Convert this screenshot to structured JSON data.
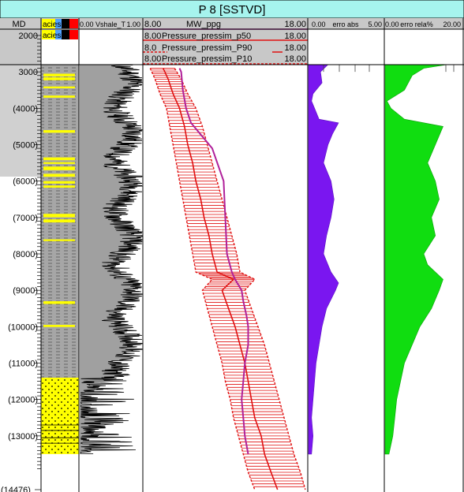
{
  "well_title": "P 8 [SSTVD]",
  "colors": {
    "title_bg": "#a6f4ee",
    "header_bg": "#c8c8c8",
    "track_fill": "#a0a0a0",
    "sand": "#ffff00",
    "shale": "#a6a6a6",
    "mw": "#b0209a",
    "pressure": "#e01010",
    "erro_abs": "#7a16f0",
    "erro_rela": "#10dd10"
  },
  "depth_track": {
    "header": "MD",
    "ticks": [
      "2000",
      "3000",
      "(4000)",
      "(5000)",
      "(6000)",
      "(7000)",
      "(8000)",
      "(9000)",
      "(10000)",
      "(11000)",
      "(12000)",
      "(13000)",
      "(14476)"
    ]
  },
  "facies_track": {
    "headers": [
      "acies",
      "acies"
    ],
    "swatches": [
      "#ffff00",
      "#4fa0ff",
      "#000000",
      "#ff0000"
    ]
  },
  "shale_track": {
    "min": "0.00",
    "name": "Vshale_T",
    "max": "1.00"
  },
  "pressure_track": {
    "headers": [
      {
        "min": "8.00",
        "name": "MW_ppg",
        "max": "18.00"
      },
      {
        "min": "8.00",
        "name": "Pressure_pressim_p50",
        "max": "18.00"
      },
      {
        "min": "8.0",
        "name": "Pressure_pressim_P90",
        "max": "18.00"
      },
      {
        "min": "8.00",
        "name": "Pressure_pressim_P10",
        "max": "18.00"
      }
    ]
  },
  "abs_track": {
    "min": "0.00",
    "name": "erro abs",
    "max": "5.00"
  },
  "rel_track": {
    "min": "0.00",
    "name": "erro rela%",
    "max": "20.00"
  },
  "chart_data": {
    "type": "line",
    "title": "P 8 [SSTVD]",
    "y_axis": "MD",
    "ylim": [
      2000,
      14476
    ],
    "series": [
      {
        "name": "MW_ppg",
        "x_range": [
          8,
          18
        ],
        "depth": [
          2900,
          3000,
          3500,
          4000,
          4400,
          5100,
          6000,
          7000,
          8000,
          8500,
          8700,
          9000,
          9300,
          9700,
          10000,
          10500,
          11000,
          11500,
          12000,
          12500,
          13000,
          13500
        ],
        "values": [
          10.2,
          10.3,
          10.4,
          10.6,
          10.9,
          12.2,
          12.9,
          13.0,
          13.1,
          13.4,
          13.6,
          14.0,
          14.1,
          14.3,
          14.4,
          14.4,
          14.2,
          14.1,
          14.0,
          14.1,
          14.2,
          14.4
        ]
      },
      {
        "name": "Pressure_pressim_p50",
        "x_range": [
          8,
          18
        ],
        "depth": [
          2900,
          3200,
          3600,
          4000,
          4500,
          5000,
          5500,
          6000,
          6500,
          7000,
          7500,
          8000,
          8500,
          8700,
          9000,
          9500,
          10000,
          10500,
          11000,
          11500,
          12000,
          12500,
          13000,
          13500,
          14000,
          14476
        ],
        "values": [
          9.2,
          9.5,
          9.8,
          10.2,
          10.5,
          10.7,
          11.0,
          11.2,
          11.5,
          11.7,
          12.0,
          12.2,
          12.5,
          13.5,
          12.8,
          13.2,
          13.6,
          13.9,
          14.2,
          14.4,
          14.6,
          14.8,
          15.2,
          15.4,
          15.8,
          16.2
        ]
      },
      {
        "name": "Pressure_pressim_P90",
        "x_range": [
          8,
          18
        ],
        "depth": [
          2900,
          3200,
          3600,
          4000,
          4500,
          5000,
          5500,
          6000,
          6500,
          7000,
          7500,
          8000,
          8500,
          8700,
          9000,
          9500,
          10000,
          10500,
          11000,
          11500,
          12000,
          12500,
          13000,
          13500,
          14000,
          14476
        ],
        "values": [
          8.4,
          8.7,
          9.0,
          9.4,
          9.6,
          9.8,
          10.0,
          10.2,
          10.4,
          10.6,
          10.8,
          11.0,
          11.2,
          12.2,
          11.6,
          11.9,
          12.2,
          12.5,
          12.8,
          13.0,
          13.3,
          13.5,
          13.8,
          14.1,
          14.4,
          14.8
        ]
      },
      {
        "name": "Pressure_pressim_P10",
        "x_range": [
          8,
          18
        ],
        "depth": [
          2900,
          3200,
          3600,
          4000,
          4500,
          5000,
          5500,
          6000,
          6500,
          7000,
          7500,
          8000,
          8500,
          8700,
          9000,
          9500,
          10000,
          10500,
          11000,
          11500,
          12000,
          12500,
          13000,
          13500,
          14000,
          14476
        ],
        "values": [
          9.9,
          10.3,
          10.7,
          11.2,
          11.6,
          11.9,
          12.2,
          12.5,
          12.8,
          13.1,
          13.4,
          13.7,
          13.9,
          14.8,
          14.2,
          14.6,
          15.0,
          15.4,
          15.7,
          16.0,
          16.3,
          16.6,
          16.9,
          17.2,
          17.6,
          17.9
        ]
      },
      {
        "name": "erro abs",
        "x_range": [
          0,
          5
        ],
        "depth": [
          2800,
          3000,
          3300,
          3600,
          3800,
          4000,
          4300,
          4400,
          4700,
          5000,
          5500,
          6000,
          6500,
          7000,
          7500,
          8000,
          8500,
          8800,
          9000,
          9500,
          10000,
          10500,
          11000,
          11500,
          12000,
          12500,
          13000,
          13500
        ],
        "values": [
          1.3,
          0.8,
          0.9,
          0.3,
          0.2,
          0.4,
          0.7,
          2.0,
          1.6,
          1.3,
          1.0,
          1.5,
          1.7,
          1.5,
          1.2,
          1.0,
          1.5,
          2.0,
          1.8,
          1.2,
          0.9,
          0.7,
          0.5,
          0.4,
          0.3,
          0.2,
          0.3,
          0.2
        ]
      },
      {
        "name": "erro rela%",
        "x_range": [
          0,
          20
        ],
        "depth": [
          2800,
          2900,
          3100,
          3500,
          3800,
          4000,
          4300,
          4500,
          5000,
          5500,
          6000,
          6500,
          7000,
          7500,
          8000,
          8300,
          8700,
          9000,
          9500,
          10000,
          10500,
          11000,
          11500,
          12000,
          12500,
          13000,
          13500
        ],
        "values": [
          16,
          10,
          7,
          5,
          0.5,
          1.5,
          5,
          15,
          13,
          11,
          13,
          14,
          12,
          13,
          10,
          11,
          15,
          14,
          12,
          9,
          7,
          5,
          4,
          3,
          2.5,
          2,
          1
        ]
      }
    ],
    "facies": [
      {
        "top": 2800,
        "base": 11400,
        "type": "shale"
      },
      {
        "top": 11400,
        "base": 13500,
        "type": "sand"
      }
    ]
  }
}
